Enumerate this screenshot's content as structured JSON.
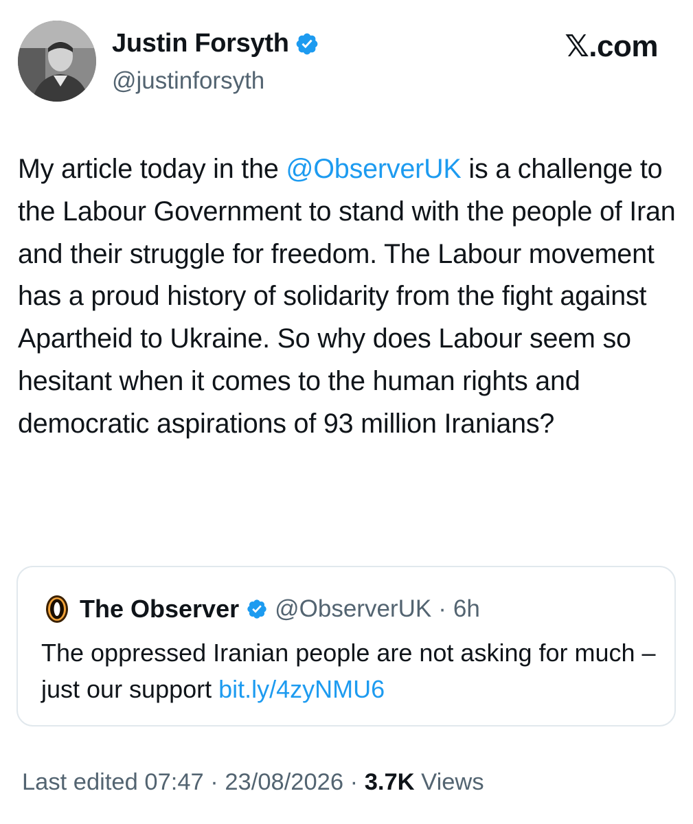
{
  "author": {
    "name": "Justin Forsyth",
    "handle": "@justinforsyth",
    "verified": true
  },
  "brand": "𝕏.com",
  "tweet": {
    "text_before": "My article today in the ",
    "mention": "@ObserverUK",
    "text_after": " is a challenge to the Labour Government to stand with the people of Iran and their struggle for freedom. The Labour movement has a proud history of solidarity from the fight against Apartheid to Ukraine. So why does Labour seem so hesitant when it comes to the human rights and democratic aspirations of 93 million Iranians?"
  },
  "quote": {
    "name": "The Observer",
    "handle": "@ObserverUK",
    "separator": "·",
    "time": "6h",
    "text": "The oppressed Iranian people are not asking for much – just our support ",
    "link": "bit.ly/4zyNMU6"
  },
  "footer": {
    "edited": "Last edited 07:47 · 23/08/2026",
    "separator": " · ",
    "views_count": "3.7K",
    "views_label": " Views"
  },
  "colors": {
    "accent": "#1d9bf0",
    "text": "#0f1419",
    "secondary": "#536471",
    "border": "#e1e8ed"
  }
}
